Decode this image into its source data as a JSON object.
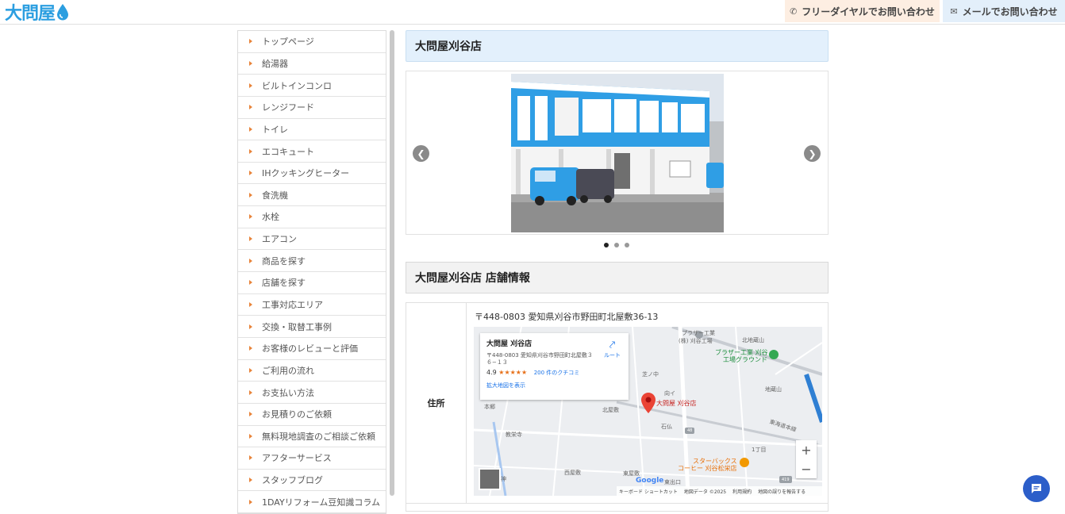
{
  "header": {
    "logo_text": "大問屋",
    "tel_button": "フリーダイヤルでお問い合わせ",
    "mail_button": "メールでお問い合わせ"
  },
  "sidebar": {
    "items": [
      {
        "label": "トップページ"
      },
      {
        "label": "給湯器"
      },
      {
        "label": "ビルトインコンロ"
      },
      {
        "label": "レンジフード"
      },
      {
        "label": "トイレ"
      },
      {
        "label": "エコキュート"
      },
      {
        "label": "IHクッキングヒーター"
      },
      {
        "label": "食洗機"
      },
      {
        "label": "水栓"
      },
      {
        "label": "エアコン"
      },
      {
        "label": "商品を探す"
      },
      {
        "label": "店舗を探す"
      },
      {
        "label": "工事対応エリア"
      },
      {
        "label": "交換・取替工事例"
      },
      {
        "label": "お客様のレビューと評価"
      },
      {
        "label": "ご利用の流れ"
      },
      {
        "label": "お支払い方法"
      },
      {
        "label": "お見積りのご依頼"
      },
      {
        "label": "無料現地調査のご相談ご依頼"
      },
      {
        "label": "アフターサービス"
      },
      {
        "label": "スタッフブログ"
      },
      {
        "label": "1DAYリフォーム豆知識コラム"
      }
    ]
  },
  "main": {
    "store_title": "大問屋刈谷店",
    "slider": {
      "slide_count": 3,
      "active_index": 0
    },
    "info_title": "大問屋刈谷店 店舗情報",
    "table": {
      "address_label": "住所",
      "address_value": "〒448-0803 愛知県刈谷市野田町北屋敷36-13"
    }
  },
  "map": {
    "card_name": "大問屋 刈谷店",
    "card_address": "〒448-0803 愛知県刈谷市野田町北屋敷３６−１３",
    "rating": "4.9",
    "stars": "★★★★★",
    "reviews": "200 件のクチコミ",
    "enlarge_link": "拡大地図を表示",
    "route": "ルート",
    "pin_label": "大問屋 刈谷店",
    "labels": {
      "plaza1": "プラザー工業",
      "plaza1b": "(株) 刈谷工場",
      "plaza2": "ブラザー工業 刈谷",
      "plaza2b": "工場グラウンド",
      "kitaji": "北地蔵山",
      "shibanonaka": "芝ノ中",
      "mukai": "向イ",
      "jizo": "地蔵山",
      "honkyo": "本郷",
      "kitayashiki": "北屋敷",
      "ishibotoke": "石仏",
      "kyoeiji": "教栄寺",
      "tokaido": "東海道本線",
      "itchome": "1丁目",
      "starbucks1": "スターバックス",
      "starbucks2": "コーヒー 刈谷松栄店",
      "nishiyashiki": "西屋敷",
      "higashiyashiki": "東屋敷",
      "higashide": "東出口",
      "kami": "神",
      "route48": "48",
      "route419": "419"
    },
    "google": "Google",
    "footer": [
      "キーボード ショートカット",
      "地図データ ©2025",
      "利用規約",
      "地図の誤りを報告する"
    ]
  }
}
